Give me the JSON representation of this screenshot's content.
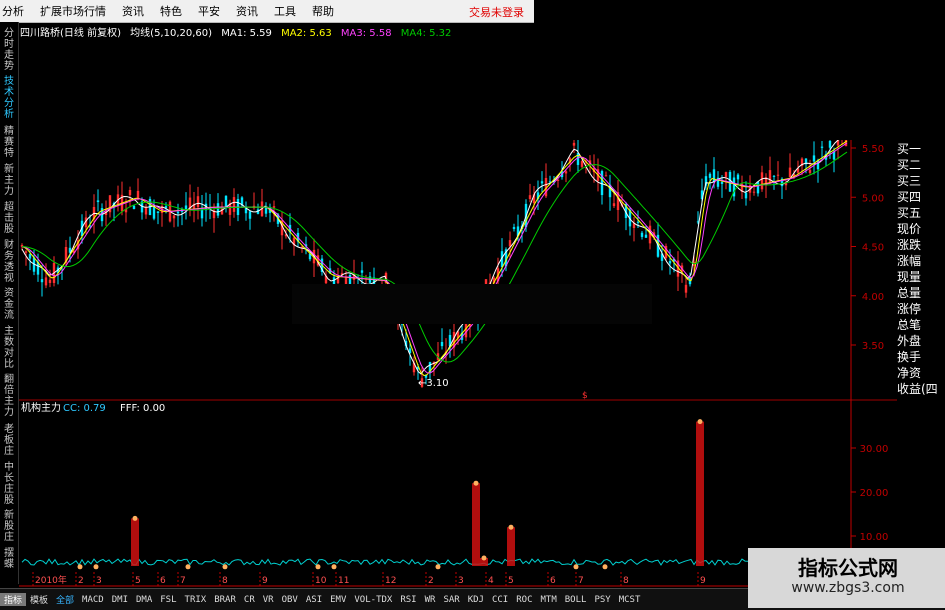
{
  "menubar": {
    "items": [
      "分析",
      "扩展市场行情",
      "资讯",
      "特色",
      "平安",
      "资讯",
      "工具",
      "帮助"
    ],
    "trade_status": "交易未登录"
  },
  "sidebar": {
    "tabs": [
      "分时走势",
      "技术分析",
      "精赛特",
      "新主力",
      "超击股",
      "财务透视",
      "资金流",
      "主数对比",
      "翻倍主力",
      "老板庄",
      "中长庄股",
      "新股庄",
      "摆蝶"
    ]
  },
  "price_chart": {
    "title": "四川路桥(日线 前复权)",
    "ma_label": "均线(5,10,20,60)",
    "ma1": "MA1: 5.59",
    "ma2": "MA2: 5.63",
    "ma3": "MA3: 5.58",
    "ma4": "MA4: 5.32",
    "low_marker": "←3.10",
    "y_ticks": [
      "5.50",
      "5.00",
      "4.50",
      "4.00",
      "3.50"
    ],
    "colors": {
      "up": "#ff2f2f",
      "down": "#00e5ff",
      "ma1": "#ffffff",
      "ma2": "#ffff00",
      "ma3": "#ff40ff",
      "ma4": "#00cc00",
      "axis": "#c00000"
    }
  },
  "indicator": {
    "name": "机构主力",
    "cc": "CC: 0.79",
    "fff": "FFF: 0.00",
    "divider_marker": "$",
    "y_ticks": [
      "30.00",
      "20.00",
      "10.00"
    ],
    "x_labels": [
      "2010年",
      "2",
      "3",
      "5",
      "6",
      "7",
      "8",
      "9",
      "10",
      "11",
      "12",
      "2",
      "3",
      "4",
      "5",
      "6",
      "7",
      "8",
      "9"
    ]
  },
  "right_panel": {
    "labels": [
      "买一",
      "买二",
      "买三",
      "买四",
      "买五",
      "现价",
      "涨跌",
      "涨幅",
      "现量",
      "总量",
      "涨停",
      "总笔",
      "外盘",
      "换手",
      "净资",
      "收益(四"
    ]
  },
  "bottom_tabs": [
    "指标",
    "模板",
    "全部",
    "MACD",
    "DMI",
    "DMA",
    "FSL",
    "TRIX",
    "BRAR",
    "CR",
    "VR",
    "OBV",
    "ASI",
    "EMV",
    "VOL-TDX",
    "RSI",
    "WR",
    "SAR",
    "KDJ",
    "CCI",
    "ROC",
    "MTM",
    "BOLL",
    "PSY",
    "MCST"
  ],
  "watermark": {
    "title": "指标公式网",
    "url": "www.zbgs3.com"
  }
}
